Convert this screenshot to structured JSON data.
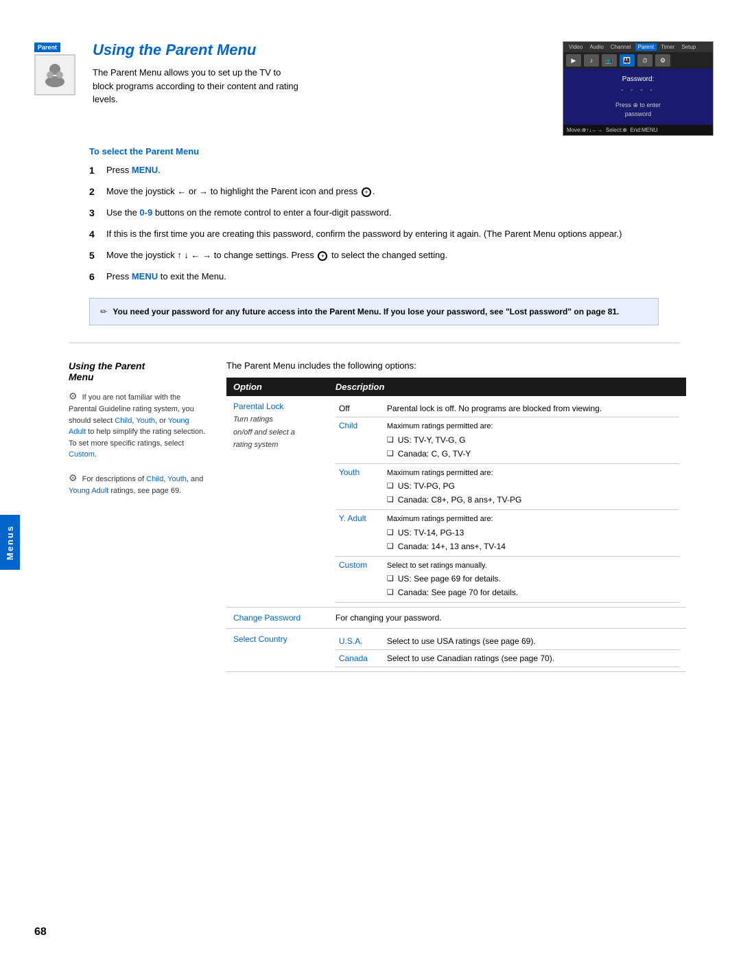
{
  "page": {
    "number": "68",
    "sidebar_label": "Menus"
  },
  "top_section": {
    "badge_label": "Parent",
    "title": "Using the Parent Menu",
    "intro": "The Parent Menu allows you to set up the TV to block programs according to their content and rating levels."
  },
  "select_parent_menu": {
    "heading": "To select the Parent Menu",
    "steps": [
      {
        "num": "1",
        "text": "Press ",
        "highlight": "MENU",
        "after": "."
      },
      {
        "num": "2",
        "text": "Move the joystick ← or → to highlight the Parent icon and press ⊕."
      },
      {
        "num": "3",
        "text": "Use the ",
        "highlight": "0-9",
        "after": " buttons on the remote control to enter a four-digit password."
      },
      {
        "num": "4",
        "text": "If this is the first time you are creating this password, confirm the password by entering it again. (The Parent Menu options appear.)"
      },
      {
        "num": "5",
        "text": "Move the joystick ↑ ↓ ← → to change settings. Press ⊕ to select the changed setting."
      },
      {
        "num": "6",
        "text": "Press ",
        "highlight": "MENU",
        "after": " to exit the Menu."
      }
    ]
  },
  "note": {
    "text": "You need your password for any future access into the Parent Menu. If you lose your password, see \"Lost password\" on page 81."
  },
  "tv_screen": {
    "menu_items": [
      "Video",
      "Audio",
      "Channel",
      "Parent",
      "Timer",
      "Setup"
    ],
    "active_menu": "Parent",
    "password_label": "Password:",
    "password_dashes": "- - - -",
    "press_text": "Press ⊕ to enter\npassword",
    "bottom_bar": "Move:⊕↑↓←→  Select:⊕  End:MENU"
  },
  "bottom_section": {
    "sidebar_title": "Using the Parent Menu",
    "sidebar_note1": {
      "text_before": "If you are not familiar with the Parental Guideline rating system, you should select ",
      "link1": "Child",
      "text_middle": ", ",
      "link2": "Youth",
      "text_middle2": ", or ",
      "link3": "Young Adult",
      "text_after": " to help simplify the rating selection. To set more specific ratings, select ",
      "link4": "Custom",
      "text_end": "."
    },
    "sidebar_note2": {
      "text_before": "For descriptions of ",
      "link1": "Child",
      "text_middle": ", ",
      "link2": "Youth",
      "text_middle2": ", and ",
      "link3": "Young Adult",
      "text_after": " ratings, see page 69."
    },
    "table_intro": "The Parent Menu includes the following options:",
    "table_headers": [
      "Option",
      "Description"
    ],
    "table_rows": [
      {
        "option": "Parental Lock",
        "sub_label": "Turn ratings on/off and select a rating system",
        "sub_options": [
          {
            "name": "",
            "desc_text": "Off",
            "desc_detail": "Parental lock is off. No programs are blocked from viewing."
          },
          {
            "name": "Child",
            "desc_text": "",
            "desc_bullets": [
              "US: TV-Y, TV-G, G",
              "Canada: C, G, TV-Y"
            ]
          },
          {
            "name": "Youth",
            "desc_text": "",
            "desc_bullets": [
              "US: TV-PG, PG",
              "Canada: C8+, PG, 8 ans+, TV-PG"
            ]
          },
          {
            "name": "Y. Adult",
            "desc_text": "",
            "desc_bullets": [
              "US: TV-14, PG-13",
              "Canada: 14+, 13 ans+, TV-14"
            ]
          },
          {
            "name": "Custom",
            "desc_text": "",
            "desc_bullets": [
              "US: See page 69 for details.",
              "Canada: See page 70 for details."
            ],
            "desc_before": "Select to set ratings manually."
          }
        ]
      },
      {
        "option": "Change Password",
        "desc_text": "For changing your password.",
        "sub_options": []
      },
      {
        "option": "Select Country",
        "sub_options": [
          {
            "name": "U.S.A.",
            "desc_text": "Select to use USA ratings (see page 69)."
          },
          {
            "name": "Canada",
            "desc_text": "Select to use Canadian ratings (see page 70)."
          }
        ]
      }
    ]
  }
}
